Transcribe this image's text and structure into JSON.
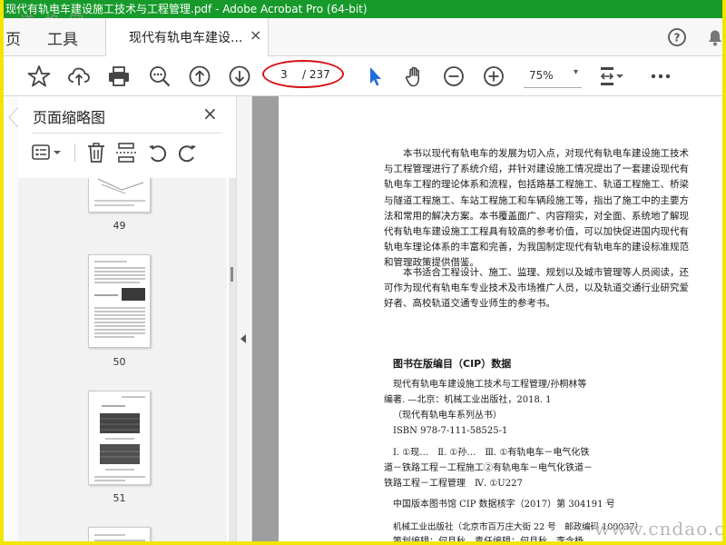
{
  "window": {
    "title": "现代有轨电车建设施工技术与工程管理.pdf - Adobe Acrobat Pro (64-bit)"
  },
  "watermark_top": "道 格 网",
  "watermark_bottom": "www.cndao.com",
  "nav": {
    "home": "页",
    "tools": "工具"
  },
  "doc_tab": {
    "label": "现代有轨电车建设...",
    "close": "×"
  },
  "toolbar": {
    "page_current": "3",
    "page_total": "/ 237",
    "zoom": "75%",
    "zoom_caret": "▾"
  },
  "thumbnail_panel": {
    "title": "页面缩略图",
    "close": "×",
    "pages": [
      {
        "number": "49"
      },
      {
        "number": "50"
      },
      {
        "number": "51"
      }
    ]
  },
  "document": {
    "paragraphs": [
      "本书以现代有轨电车的发展为切入点，对现代有轨电车建设施工技术与工程管理进行了系统介绍，并针对建设施工情况提出了一套建设现代有轨电车工程的理论体系和流程，包括路基工程施工、轨道工程施工、桥梁与隧道工程施工、车站工程施工和车辆段施工等，指出了施工中的主要方法和常用的解决方案。本书覆盖面广、内容翔实，对全面、系统地了解现代有轨电车建设施工工程具有较高的参考价值，可以加快促进国内现代有轨电车理论体系的丰富和完善，为我国制定现代有轨电车的建设标准规范和管理政策提供借鉴。",
      "本书适合工程设计、施工、监理、规划以及城市管理等人员阅读，还可作为现代有轨电车专业技术及市场推广人员，以及轨道交通行业研究爱好者、高校轨道交通专业师生的参考书。"
    ],
    "cip_heading": "图书在版编目（CIP）数据",
    "cip_lines": [
      "现代有轨电车建设施工技术与工程管理/孙桐林等",
      "编著. —北京：机械工业出版社，2018. 1",
      "（现代有轨电车系列丛书）",
      "ISBN 978-7-111-58525-1",
      "Ⅰ. ①现…　Ⅱ. ①孙…　Ⅲ. ①有轨电车－电气化铁",
      "道－铁路工程－工程施工②有轨电车－电气化铁道－",
      "铁路工程－工程管理　Ⅳ. ①U227",
      "中国版本图书馆 CIP 数据核字（2017）第 304191 号",
      "机械工业出版社（北京市百万庄大街 22 号　邮政编码 100037）",
      "策划编辑：何月秋　责任编辑：何月秋　李含杨"
    ]
  }
}
